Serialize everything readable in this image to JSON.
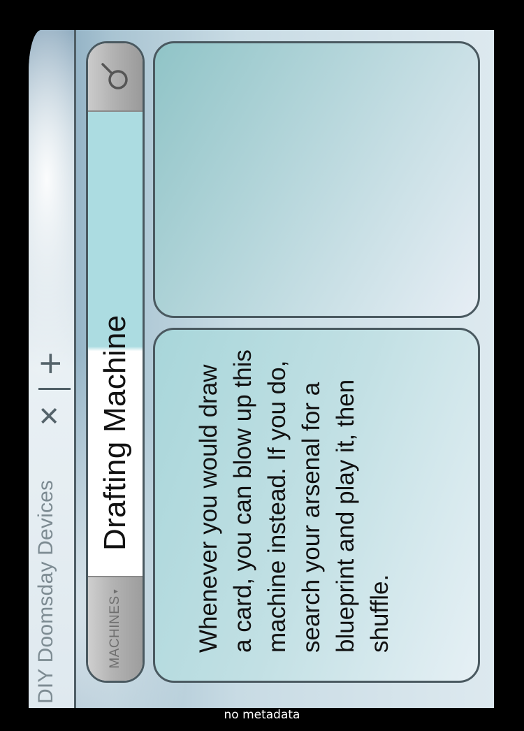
{
  "browser": {
    "tab_title": "DIY Doomsday Devices",
    "close_symbol": "✕",
    "new_tab_symbol": "+"
  },
  "search": {
    "category": "MACHINES",
    "category_caret": "▾",
    "query": "Drafting Machine",
    "button_icon": "magnifier-icon"
  },
  "card": {
    "rules_text": "Whenever you would draw a card, you can blow up this machine instead. If you do, search your arsenal for a blueprint and play it, then shuffle."
  },
  "footer": {
    "text": "no metadata"
  },
  "colors": {
    "accent_cyan": "#acdce1",
    "border": "#4a5960",
    "footer_bg": "#000000"
  }
}
